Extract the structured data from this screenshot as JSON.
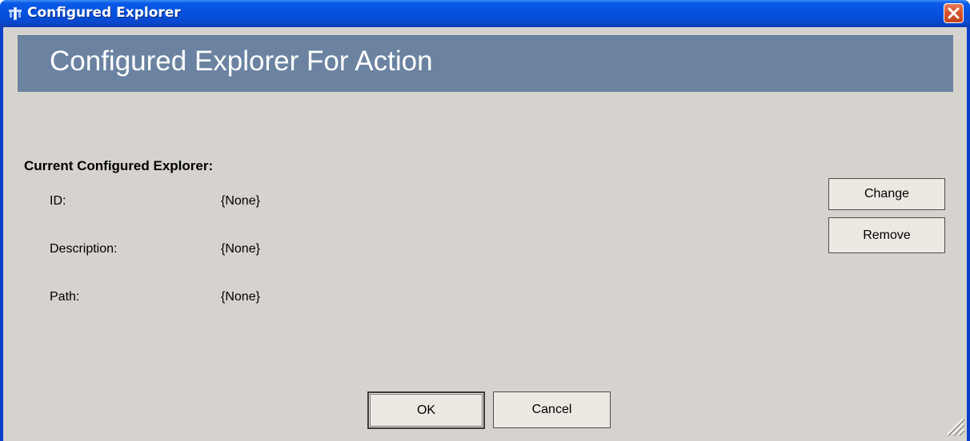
{
  "window": {
    "title": "Configured Explorer",
    "icons": {
      "app": "app-icon",
      "close": "close-icon",
      "resize": "resize-grip-icon"
    }
  },
  "banner": {
    "title": "Configured Explorer For Action"
  },
  "section": {
    "label": "Current Configured Explorer:",
    "fields": [
      {
        "label": "ID:",
        "value": "{None}"
      },
      {
        "label": "Description:",
        "value": "{None}"
      },
      {
        "label": "Path:",
        "value": "{None}"
      }
    ]
  },
  "side_buttons": {
    "change": "Change",
    "remove": "Remove"
  },
  "footer_buttons": {
    "ok": "OK",
    "cancel": "Cancel"
  },
  "colors": {
    "titlebar": "#0453e0",
    "banner": "#6b83a1",
    "client": "#d6d3ce",
    "close": "#d5512a"
  }
}
